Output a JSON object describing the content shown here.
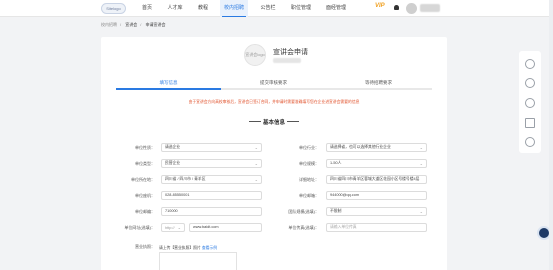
{
  "nav": {
    "logo_text": "Sitelogo",
    "items": [
      "首页",
      "人才库",
      "教程",
      "校内招聘",
      "公告栏",
      "职位管理",
      "面经管理"
    ],
    "active_index": 3,
    "vip": "VIP"
  },
  "breadcrumb": [
    "校内招聘",
    "宣讲会",
    "申请宣讲会"
  ],
  "header": {
    "company_logo_text": "宣讲会logo",
    "title": "宣讲会申请"
  },
  "tabs": [
    "填写信息",
    "提交审核要求",
    "等待招聘要求"
  ],
  "notice": "由于宣讲会方向高校审核后，宣讲会已签订合同，并申请时需要准确填写您在企业进宣讲会需要的信息",
  "section_title": "基本信息",
  "form": {
    "rows": [
      {
        "left_label": "单位性质：",
        "left_value": "请选企业",
        "left_type": "select",
        "right_label": "单位行业：",
        "right_value": "请选择省，也可以选择其他行业企业",
        "right_type": "select"
      },
      {
        "left_label": "单位类型：",
        "left_value": "民营企业",
        "left_type": "select",
        "right_label": "单位规模：",
        "right_value": "1-50人",
        "right_type": "select"
      },
      {
        "left_label": "单位所在地：",
        "left_value": "四川省 / 四川市 / 青羊区",
        "left_type": "select",
        "right_label": "详细地址：",
        "right_value": "四川省四川市青羊区蓉城大道区花园小区号楼号楼4层",
        "right_type": "text"
      },
      {
        "left_label": "单位座机：",
        "left_value": "028-85550001",
        "left_type": "text",
        "right_label": "单位邮箱：",
        "right_value": "944000@qq.com",
        "right_type": "text"
      },
      {
        "left_label": "单位邮编：",
        "left_value": "710000",
        "left_type": "text",
        "right_label": "团队规模(选填)：",
        "right_value": "不限制",
        "right_type": "select"
      },
      {
        "left_label": "单位网址(选填)：",
        "left_prefix": "http://",
        "left_value": "www.baidt.com",
        "left_type": "text",
        "right_label": "单位传真(选填)：",
        "right_value": "请输入单位传真",
        "right_type": "placeholder"
      }
    ],
    "upload_label": "营业执照：",
    "upload_hint": "请上传【营业执照】照片",
    "upload_link": "查看示例"
  },
  "colors": {
    "accent": "#2a7ae2",
    "notice": "#e0502a",
    "vip": "#f0a020"
  },
  "side_icons": [
    "chat-icon",
    "headset-icon",
    "clock-icon",
    "qr-code-icon",
    "help-icon"
  ]
}
